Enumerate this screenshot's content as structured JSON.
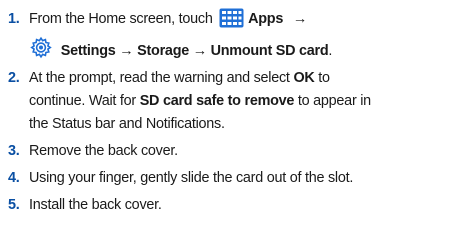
{
  "colors": {
    "number": "#0a4fa3",
    "icon_blue": "#1f6fd6",
    "text": "#1a1a1a"
  },
  "steps": [
    {
      "number": "1.",
      "line1": {
        "pre": "From the Home screen, touch",
        "icon": "apps-grid-icon",
        "bold": "Apps",
        "arrow": "→"
      },
      "line2": {
        "icon": "settings-gear-icon",
        "bold": "Settings → Storage → Unmount SD card",
        "post": "."
      }
    },
    {
      "number": "2.",
      "line1": {
        "pre": "At the prompt, read the warning and select",
        "bold": "OK",
        "post": "to"
      },
      "line2": {
        "pre": "continue. Wait for",
        "bold": "SD card safe to remove",
        "post": "to appear in"
      },
      "line3": "the Status bar and Notifications."
    },
    {
      "number": "3.",
      "text": "Remove the back cover."
    },
    {
      "number": "4.",
      "text": "Using your finger, gently slide the card out of the slot."
    },
    {
      "number": "5.",
      "text": "Install the back cover."
    }
  ]
}
